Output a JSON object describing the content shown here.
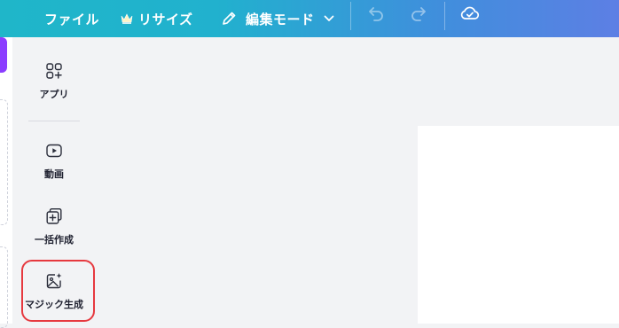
{
  "toolbar": {
    "file_label": "ファイル",
    "resize_label": "リサイズ",
    "edit_mode_label": "編集モード",
    "icons": {
      "resize": "crown-icon",
      "edit_mode": "pencil-icon",
      "edit_mode_toggle": "chevron-down-icon",
      "undo": "undo-icon",
      "redo": "redo-icon",
      "save_status": "cloud-check-icon"
    }
  },
  "sidebar": {
    "items": [
      {
        "label": "アプリ",
        "icon": "apps-icon"
      },
      {
        "label": "動画",
        "icon": "video-play-icon"
      },
      {
        "label": "一括作成",
        "icon": "bulk-create-icon"
      },
      {
        "label": "マジック生成",
        "icon": "magic-image-icon",
        "highlighted": true
      }
    ]
  },
  "colors": {
    "topbar_gradient": [
      "#1fb6c9",
      "#5d7fe4"
    ],
    "accent_purple": "#8b3dff",
    "highlight_red": "#e6393f"
  }
}
